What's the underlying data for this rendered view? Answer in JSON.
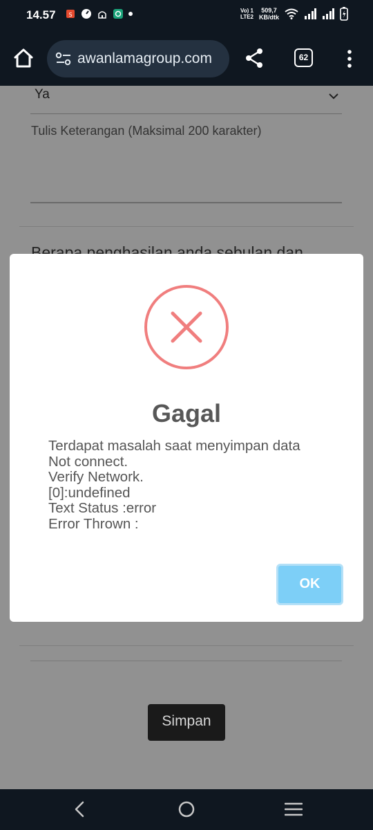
{
  "status_bar": {
    "time": "14.57",
    "volte_top": "Vo) 1",
    "volte_bottom": "LTE2",
    "net_speed_value": "509,7",
    "net_speed_unit": "KB/dtk"
  },
  "browser": {
    "url": "awanlamagroup.com",
    "tab_count": "62"
  },
  "page": {
    "select_value": "Ya",
    "textarea_placeholder": "Tulis Keterangan (Maksimal 200 karakter)",
    "question_partial": "Berapa penghasilan anda sebulan dan",
    "save_label": "Simpan"
  },
  "dialog": {
    "title": "Gagal",
    "message_lines": [
      "Terdapat masalah saat menyimpan data",
      "Not connect.",
      "Verify Network.",
      "[0]:undefined",
      "Text Status :error",
      "Error Thrown :"
    ],
    "ok_label": "OK"
  },
  "colors": {
    "error_red": "#f07e7e",
    "ok_blue": "#7dcff7",
    "dark_bar": "#0f1720"
  }
}
